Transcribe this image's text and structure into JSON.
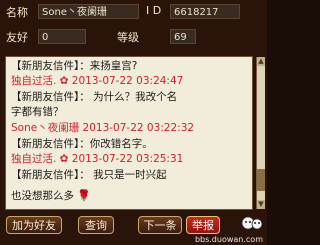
{
  "profile": {
    "name_label": "名称",
    "name_value": "Sone丶夜阑珊",
    "id_label": "I  D",
    "id_value": "6618217",
    "friend_label": "友好",
    "friend_value": "0",
    "level_label": "等级",
    "level_value": "69"
  },
  "messages": [
    {
      "text": "【新朋友信件】：来扬皇宫?",
      "style": "sys"
    },
    {
      "text": "独自过活. ✿  2013-07-22 03:24:47",
      "style": "red"
    },
    {
      "text": "【新朋友信件】：      为什么？我改个名",
      "style": "sys"
    },
    {
      "text": "字都有错？",
      "style": "sys"
    },
    {
      "text": "Sone丶夜阑珊  2013-07-22 03:22:32",
      "style": "red"
    },
    {
      "text": "【新朋友信件】：你改错名字。",
      "style": "sys"
    },
    {
      "text": "独自过活. ✿  2013-07-22 03:25:31",
      "style": "red"
    },
    {
      "text": "【新朋友信件】：      我只是一时兴起",
      "style": "sys"
    },
    {
      "text": "也没想那么多",
      "style": "sys"
    }
  ],
  "buttons": {
    "add_friend": "加为好友",
    "search": "查询",
    "next": "下一条",
    "report": "举报"
  },
  "watermark": "bbs.duowan.com"
}
